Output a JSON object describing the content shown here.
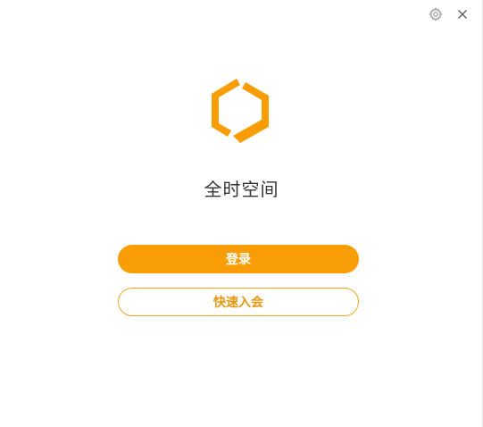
{
  "app": {
    "title": "全时空间"
  },
  "titlebar": {
    "settings_icon": "gear-icon",
    "close_icon": "close-icon"
  },
  "logo": {
    "icon": "hexagon-logo-icon",
    "color": "#f89d05"
  },
  "actions": {
    "login_label": "登录",
    "join_label": "快速入会"
  },
  "colors": {
    "accent": "#f89d05",
    "outline": "#f4a623"
  }
}
